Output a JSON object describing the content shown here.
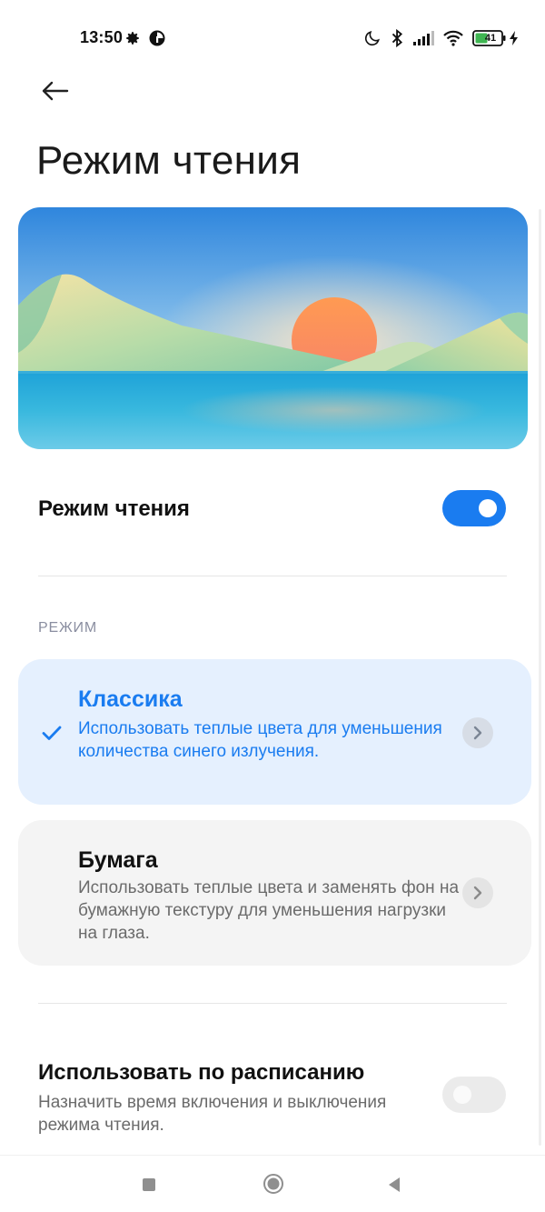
{
  "status_bar": {
    "time": "13:50",
    "battery_level": "41",
    "icons": [
      "gear-icon",
      "app-status-icon",
      "moon-icon",
      "bluetooth-icon",
      "signal-icon",
      "wifi-icon",
      "battery-icon",
      "charging-icon"
    ]
  },
  "header": {
    "back_icon": "arrow-left-icon",
    "title": "Режим чтения"
  },
  "reading_mode": {
    "label": "Режим чтения",
    "enabled": true
  },
  "modes": {
    "section_label": "РЕЖИМ",
    "items": [
      {
        "title": "Классика",
        "description": "Использовать теплые цвета для уменьшения количества синего излучения.",
        "selected": true
      },
      {
        "title": "Бумага",
        "description": "Использовать теплые цвета и заменять фон на бумажную текстуру для уменьшения нагрузки на глаза.",
        "selected": false
      }
    ]
  },
  "schedule": {
    "title": "Использовать по расписанию",
    "subtitle": "Назначить время включения и выключения режима чтения.",
    "enabled": false
  },
  "nav_bar": {
    "icons": [
      "recents-square-icon",
      "home-circle-icon",
      "back-triangle-icon"
    ]
  },
  "colors": {
    "accent": "#1a7cf0",
    "selected_card_bg": "#e5f0fe",
    "card_bg": "#f4f4f4",
    "secondary_text": "#6b6b6b",
    "section_label": "#8a8ea0"
  }
}
